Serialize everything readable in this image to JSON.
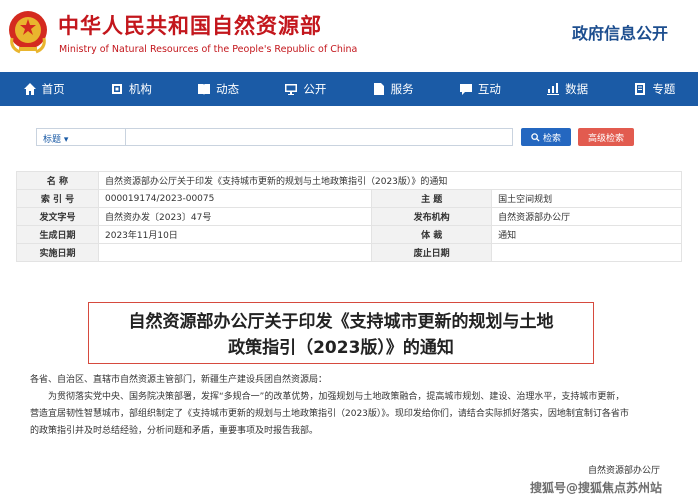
{
  "header": {
    "title_cn": "中华人民共和国自然资源部",
    "title_en": "Ministry of Natural Resources of the People's Republic of China",
    "right_label": "政府信息公开"
  },
  "nav": {
    "items": [
      {
        "label": "首页",
        "icon": "home-icon"
      },
      {
        "label": "机构",
        "icon": "org-icon"
      },
      {
        "label": "动态",
        "icon": "book-icon"
      },
      {
        "label": "公开",
        "icon": "monitor-icon"
      },
      {
        "label": "服务",
        "icon": "document-icon"
      },
      {
        "label": "互动",
        "icon": "chat-icon"
      },
      {
        "label": "数据",
        "icon": "chart-icon"
      },
      {
        "label": "专题",
        "icon": "topic-icon"
      }
    ]
  },
  "search": {
    "select_value": "标题",
    "input_value": "",
    "search_label": "检索",
    "advanced_label": "高级检索"
  },
  "info": {
    "name_key": "名  称",
    "name_value": "自然资源部办公厅关于印发《支持城市更新的规划与土地政策指引（2023版）》的通知",
    "index_key": "索 引 号",
    "index_value": "000019174/2023-00075",
    "subject_key": "主  题",
    "subject_value": "国土空间规划",
    "docno_key": "发文字号",
    "docno_value": "自然资办发〔2023〕47号",
    "issuer_key": "发布机构",
    "issuer_value": "自然资源部办公厅",
    "date_key": "生成日期",
    "date_value": "2023年11月10日",
    "genre_key": "体  裁",
    "genre_value": "通知",
    "impl_key": "实施日期",
    "impl_value": "",
    "expire_key": "废止日期",
    "expire_value": ""
  },
  "doc": {
    "title_line1": "自然资源部办公厅关于印发《支持城市更新的规划与土地",
    "title_line2": "政策指引（2023版）》的通知",
    "salutation": "各省、自治区、直辖市自然资源主管部门，新疆生产建设兵团自然资源局：",
    "para_line1": "为贯彻落实党中央、国务院决策部署，发挥“多规合一”的改革优势，加强规划与土地政策融合，提高城市规划、建设、治理水平，支持城市更新，",
    "para_line2": "营造宜居韧性智慧城市，部组织制定了《支持城市更新的规划与土地政策指引（2023版）》。现印发给你们，请结合实际抓好落实，因地制宜制订各省市",
    "para_line3": "的政策指引并及时总结经验，分析问题和矛盾，重要事项及时报告我部。",
    "signature": "自然资源部办公厅",
    "watermark": "搜狐号@搜狐焦点苏州站"
  }
}
